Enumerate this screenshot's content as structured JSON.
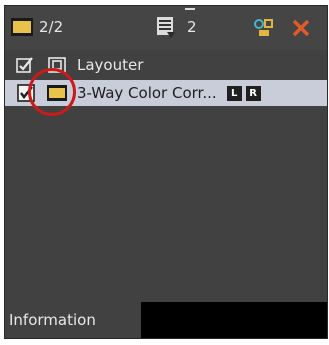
{
  "toolbar": {
    "count_label": "2/2",
    "tracks_label": "2",
    "icons": [
      "film-icon",
      "tracks-icon",
      "rearrange-icon",
      "close-icon"
    ]
  },
  "list": {
    "items": [
      {
        "label": "Layouter",
        "checked": true,
        "selected": false,
        "icon": "layouter-icon"
      },
      {
        "label": "3-Way Color Corr...",
        "checked": true,
        "selected": true,
        "icon": "film-icon",
        "badges": [
          "L",
          "R"
        ]
      }
    ]
  },
  "tabs": {
    "information_label": "Information"
  },
  "colors": {
    "panel_bg": "#414141",
    "selected_row": "#c9cdd9",
    "close_x": "#e05a2a",
    "callout_circle": "#cc1a1a"
  }
}
